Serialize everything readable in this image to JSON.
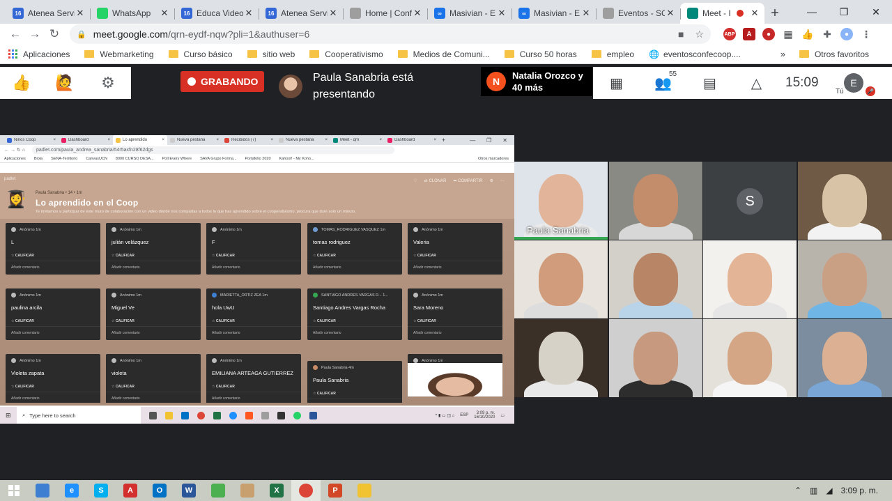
{
  "browser": {
    "tabs": [
      {
        "label": "Atenea Servi",
        "icon": "atenea-icon",
        "color": "#3367d6",
        "glyph": "16"
      },
      {
        "label": "WhatsApp",
        "icon": "whatsapp-icon",
        "color": "#25d366",
        "glyph": ""
      },
      {
        "label": "Educa Video",
        "icon": "atenea-icon",
        "color": "#3367d6",
        "glyph": "16"
      },
      {
        "label": "Atenea Servi",
        "icon": "atenea-icon",
        "color": "#3367d6",
        "glyph": "16"
      },
      {
        "label": "Home | Conf",
        "icon": "conf-icon",
        "color": "#9e9e9e",
        "glyph": ""
      },
      {
        "label": "Masivian - E",
        "icon": "masivian-icon",
        "color": "#1a73e8",
        "glyph": "∞"
      },
      {
        "label": "Masivian - E",
        "icon": "masivian-icon",
        "color": "#1a73e8",
        "glyph": "∞"
      },
      {
        "label": "Eventos - SC",
        "icon": "conf-icon",
        "color": "#9e9e9e",
        "glyph": ""
      },
      {
        "label": "Meet - I",
        "icon": "meet-icon",
        "color": "#00897b",
        "glyph": ""
      }
    ],
    "url_host": "meet.google.com",
    "url_path": "/qrn-eydf-nqw?pli=1&authuser=6",
    "bookmarks": [
      "Aplicaciones",
      "Webmarketing",
      "Curso básico",
      "sitio web",
      "Cooperativismo",
      "Medios de Comuni...",
      "Curso 50 horas",
      "empleo",
      "eventosconfecoop...."
    ],
    "other_bookmarks": "Otros favoritos",
    "ext_abp": "ABP"
  },
  "meet": {
    "recording_label": "GRABANDO",
    "presenter_text": "Paula Sanabria está presentando",
    "others_initial": "N",
    "others_text": "Natalia Orozco y 40 más",
    "participants_count": "55",
    "time": "15:09",
    "me_initial": "E",
    "me_label": "Tú"
  },
  "share": {
    "tabs": [
      "Niños Coop",
      "Dashboard",
      "Lo aprendido",
      "Nueva pestaña",
      "Recibidos (7)",
      "Nueva pestaña",
      "Meet - qrn",
      "Dashboard"
    ],
    "url": "padlet.com/paula_andrea_sanabria/54r5axfn28f62dgs",
    "bookmarks": [
      "Aplicaciones",
      "Biola",
      "SENA-Territorio",
      "CanvasUCN",
      "8000 CURSO DESA...",
      "Poll Every Where",
      "SAVA Grupo Forma...",
      "Portafolio 2020",
      "Kahoot! - My Koho..."
    ],
    "other_bookmarks": "Otros marcadores",
    "padlet_logo": "padlet",
    "author_meta": "Paula Sanabria • 14 • 1m",
    "title": "Lo aprendido en el Coop",
    "description": "Te invitamos a participar de este muro de colaboración con un video donde nos compartas a todos lo que has aprendido sobre el cooperativismo, procura que dure solo un minuto.",
    "actions": [
      "♡",
      "⇄ CLONAR",
      "➦ COMPARTIR",
      "⚙",
      "⋯"
    ],
    "cards": [
      {
        "author": "Anónimo  1m",
        "text": "L"
      },
      {
        "author": "Anónimo  1m",
        "text": "julián velázquez"
      },
      {
        "author": "Anónimo  1m",
        "text": "F"
      },
      {
        "author": "TOMAS_RODRIGUEZ VASQUEZ  1m",
        "text": "tomas rodriguez"
      },
      {
        "author": "Anónimo  1m",
        "text": "Valeria"
      },
      {
        "author": "Anónimo  1m",
        "text": "paulina arcila"
      },
      {
        "author": "Anónimo  1m",
        "text": "Miguel Ve"
      },
      {
        "author": "MARIETTA_ORTIZ ZEA  1m",
        "text": "hola UwU"
      },
      {
        "author": "SANTIAGO ANDRES VARGAS R...  1...",
        "text": "Santiago Andres Vargas Rocha"
      },
      {
        "author": "Anónimo  1m",
        "text": "Sara Moreno"
      },
      {
        "author": "Anónimo  1m",
        "text": "Violeta zapata"
      },
      {
        "author": "Anónimo  1m",
        "text": "violeta"
      },
      {
        "author": "Anónimo  1m",
        "text": "EMILIANA ARTEAGA GUTIERREZ"
      },
      {
        "author": "Paula Sanabria  4m",
        "text": "Paula Sanabria"
      },
      {
        "author": "Anónimo  1m",
        "text": ""
      }
    ],
    "rate_label": "☆ CALIFICAR",
    "comment_label": "Añadir comentario",
    "fab": "+",
    "search_placeholder": "Type here to search",
    "tray_lang": "ESP",
    "tray_time": "3:09 p. m.",
    "tray_date": "16/10/2020"
  },
  "tiles": [
    {
      "name": "Paula Sanabria",
      "bg": "#dfe4ea",
      "skin": "#e2b49a",
      "shirt": "#eaeaea"
    },
    {
      "name": "",
      "bg": "#8a8a85",
      "skin": "#c38d6c",
      "shirt": "#d7d7d7"
    },
    {
      "name": "",
      "bg": "#3c4043",
      "avatar": "S"
    },
    {
      "name": "",
      "bg": "#6e5a45",
      "skin": "#d9c3a7",
      "shirt": "#f2f2f2"
    },
    {
      "name": "",
      "bg": "#e8e4dd",
      "skin": "#d19c7b",
      "shirt": "#ddd"
    },
    {
      "name": "",
      "bg": "#d2d0c9",
      "skin": "#b98567",
      "shirt": "#b9d3e8"
    },
    {
      "name": "",
      "bg": "#f3f1ee",
      "skin": "#e3b496",
      "shirt": "#e6e6e6"
    },
    {
      "name": "",
      "bg": "#b9b4ab",
      "skin": "#caa085",
      "shirt": "#6fb6e6"
    },
    {
      "name": "",
      "bg": "#3a3028",
      "skin": "#d7d2c8",
      "shirt": "#e8e8e8"
    },
    {
      "name": "",
      "bg": "#cfcfcf",
      "skin": "#c79a80",
      "shirt": "#2d2d2d"
    },
    {
      "name": "",
      "bg": "#e4e1db",
      "skin": "#d4a685",
      "shirt": "#f5f5f5"
    },
    {
      "name": "",
      "bg": "#7c8da0",
      "skin": "#dcb093",
      "shirt": "#7aa6d6"
    }
  ],
  "taskbar": {
    "apps": [
      {
        "icon": "snip-icon",
        "color": "#3f7fd1",
        "glyph": ""
      },
      {
        "icon": "ie-icon",
        "color": "#1e90ff",
        "glyph": "e"
      },
      {
        "icon": "skype-icon",
        "color": "#00aff0",
        "glyph": "S"
      },
      {
        "icon": "acrobat-icon",
        "color": "#d32f2f",
        "glyph": "A"
      },
      {
        "icon": "outlook-icon",
        "color": "#0072c6",
        "glyph": "O"
      },
      {
        "icon": "word-icon",
        "color": "#2b579a",
        "glyph": "W"
      },
      {
        "icon": "greenshot-icon",
        "color": "#4caf50",
        "glyph": ""
      },
      {
        "icon": "paint-icon",
        "color": "#c8a070",
        "glyph": ""
      },
      {
        "icon": "excel-icon",
        "color": "#217346",
        "glyph": "X"
      },
      {
        "icon": "chrome-icon",
        "color": "#db4437",
        "glyph": ""
      },
      {
        "icon": "powerpoint-icon",
        "color": "#d24726",
        "glyph": "P"
      },
      {
        "icon": "explorer-icon",
        "color": "#f1c232",
        "glyph": ""
      }
    ],
    "time": "3:09 p. m."
  }
}
